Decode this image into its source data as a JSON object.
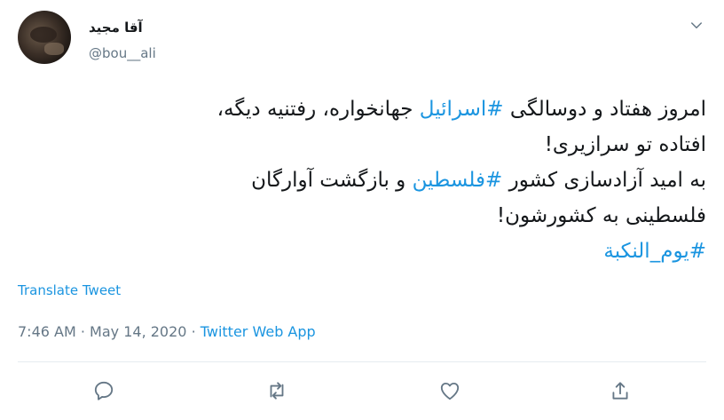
{
  "tweet": {
    "display_name": "آقا مجید",
    "handle": "@bou__ali",
    "text": {
      "line1": {
        "before": "امروز هفتاد و دوسالگی ",
        "hashtag": "#اسرائیل",
        "after": " جهانخواره، رفتنیه دیگه،"
      },
      "line2": "افتاده تو سرازیری!",
      "line3": {
        "before": "به امید آزادسازی کشور ",
        "hashtag": "#فلسطین",
        "after": " و بازگشت آوارگان"
      },
      "line4": "فلسطینی به کشورشون!",
      "line5": "#یوم_النکبة"
    },
    "translate_label": "Translate Tweet",
    "time": "7:46 AM",
    "date": "May 14, 2020",
    "separator": "·",
    "source": "Twitter Web App"
  },
  "colors": {
    "link": "#1b95e0",
    "secondary": "#657786",
    "text": "#14171a"
  },
  "icons": [
    "chevron-down-icon",
    "reply-icon",
    "retweet-icon",
    "like-icon",
    "share-icon"
  ]
}
